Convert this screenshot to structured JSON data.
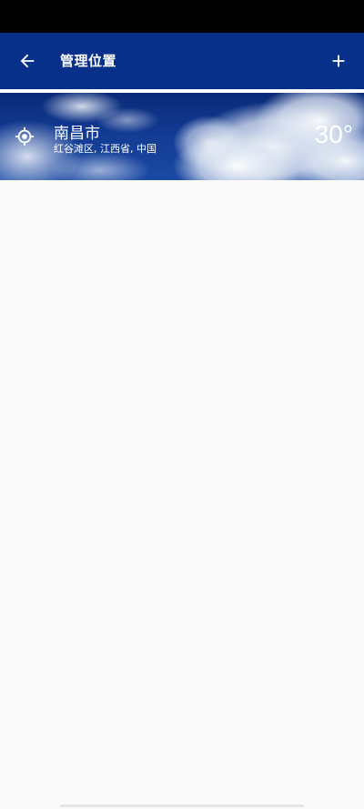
{
  "app_bar": {
    "title": "管理位置",
    "background_color": "#07308a",
    "back_icon": "arrow-left-icon",
    "add_icon": "plus-icon"
  },
  "locations": [
    {
      "city": "南昌市",
      "region": "红谷滩区, 江西省, 中国",
      "temperature": "30°",
      "icon": "location-target-icon",
      "background": "cloudy-sky"
    }
  ]
}
